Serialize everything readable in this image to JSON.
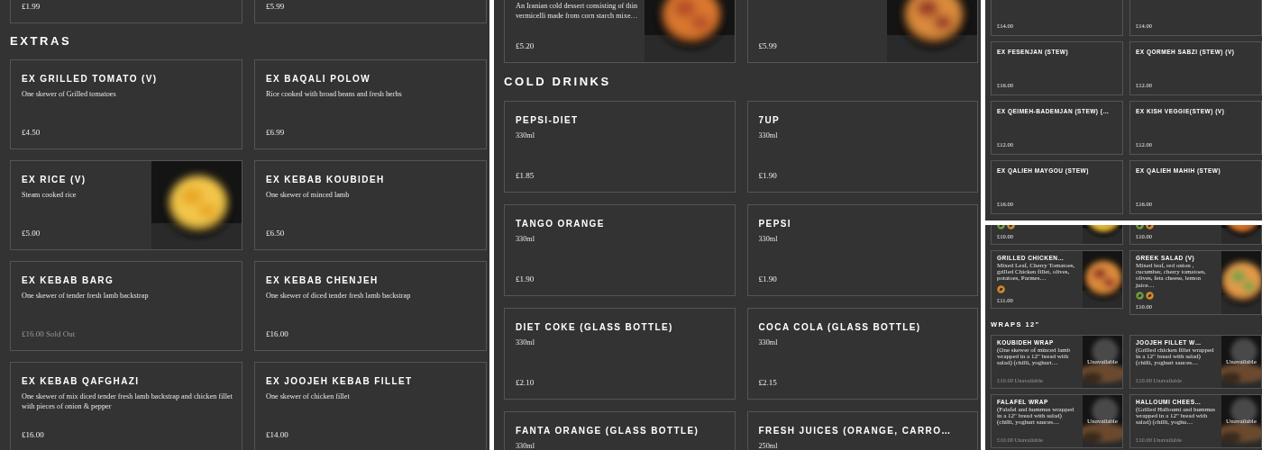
{
  "panels": [
    {
      "items": [
        {
          "kind": "card",
          "price": "£1.99"
        },
        {
          "kind": "card",
          "price": "£5.99"
        },
        {
          "kind": "heading",
          "title": "EXTRAS"
        },
        {
          "kind": "card",
          "title": "EX GRILLED TOMATO (V)",
          "description": "One skewer of Grilled tomatoes",
          "price": "£4.50"
        },
        {
          "kind": "card",
          "title": "EX BAQALI POLOW",
          "description": "Rice cooked with broad beans and fresh herbs",
          "price": "£6.99"
        },
        {
          "kind": "card",
          "title": "EX RICE (V)",
          "description": "Steam cooked rice",
          "price": "£5.00",
          "image": true
        },
        {
          "kind": "card",
          "title": "EX KEBAB KOUBIDEH",
          "description": "One skewer of minced lamb",
          "price": "£6.50"
        },
        {
          "kind": "card",
          "title": "EX KEBAB BARG",
          "description": "One skewer of tender fresh lamb backstrap",
          "price": "£16.00",
          "note": "Sold Out",
          "greyed": true
        },
        {
          "kind": "card",
          "title": "EX KEBAB CHENJEH",
          "description": "One skewer of diced tender fresh lamb backstrap",
          "price": "£16.00"
        },
        {
          "kind": "card",
          "title": "EX KEBAB QAFGHAZI",
          "description": "One skewer of mix diced tender fresh lamb backstrap and chicken fillet with pieces of onion & pepper",
          "price": "£16.00"
        },
        {
          "kind": "card",
          "title": "EX JOOJEH KEBAB FILLET",
          "description": "One skewer of chicken fillet",
          "price": "£14.00"
        }
      ]
    },
    {
      "items": [
        {
          "kind": "card",
          "description": "An Iranian cold dessert consisting of thin vermicelli made from corn starch mixe…",
          "price": "£5.20",
          "image": true
        },
        {
          "kind": "card",
          "price": "£5.99",
          "image": true
        },
        {
          "kind": "heading",
          "title": "COLD DRINKS"
        },
        {
          "kind": "card",
          "title": "PEPSI-DIET",
          "description": "330ml",
          "price": "£1.85"
        },
        {
          "kind": "card",
          "title": "7UP",
          "description": "330ml",
          "price": "£1.90"
        },
        {
          "kind": "card",
          "title": "TANGO ORANGE",
          "description": "330ml",
          "price": "£1.90"
        },
        {
          "kind": "card",
          "title": "PEPSI",
          "description": "330ml",
          "price": "£1.90"
        },
        {
          "kind": "card",
          "title": "DIET COKE (GLASS BOTTLE)",
          "description": "330ml",
          "price": "£2.10"
        },
        {
          "kind": "card",
          "title": "COCA COLA (GLASS BOTTLE)",
          "description": "330ml",
          "price": "£2.15"
        },
        {
          "kind": "card",
          "title": "FANTA ORANGE (GLASS BOTTLE)",
          "description": "330ml"
        },
        {
          "kind": "card",
          "title": "FRESH JUICES (ORANGE, CARRO…",
          "description": "250ml"
        }
      ]
    },
    {
      "items": [
        {
          "kind": "card",
          "price": "£14.00"
        },
        {
          "kind": "card",
          "price": "£14.00"
        },
        {
          "kind": "card",
          "title": "EX FESENJAN (STEW)",
          "price": "£16.00"
        },
        {
          "kind": "card",
          "title": "EX QORMEH SABZI (STEW) (V)",
          "price": "£12.00"
        },
        {
          "kind": "card",
          "title": "EX QEIMEH-BADEMJAN (STEW) (…",
          "price": "£12.00"
        },
        {
          "kind": "card",
          "title": "EX KISH VEGGIE(STEW) (V)",
          "price": "£12.00"
        },
        {
          "kind": "card",
          "title": "EX QALIEH MAYGOU (STEW)",
          "price": "£16.00"
        },
        {
          "kind": "card",
          "title": "EX QALIEH MAHIH (STEW)",
          "price": "£16.00"
        }
      ]
    },
    {
      "items": [
        {
          "kind": "card",
          "badges": [
            {
              "color": "#6f9a3e"
            },
            {
              "color": "#d1892b"
            }
          ],
          "price": "£10.00",
          "image": true
        },
        {
          "kind": "card",
          "badges": [
            {
              "color": "#6f9a3e"
            },
            {
              "color": "#d1892b"
            }
          ],
          "price": "£10.00",
          "image": true
        },
        {
          "kind": "card",
          "title": "GRILLED CHICKEN…",
          "description": "Mixed Leaf, Cherry Tomatoes, grilled Chicken fillet, olives, potatoes, Parmes…",
          "badges": [
            {
              "color": "#d1892b"
            }
          ],
          "price": "£11.00",
          "image": true
        },
        {
          "kind": "card",
          "title": "GREEK SALAD (V)",
          "description": "Mixed leaf, red onion , cucumber, cherry tomatoes, olives, feta cheese, lemon juice…",
          "badges": [
            {
              "color": "#6f9a3e"
            },
            {
              "color": "#d1892b"
            }
          ],
          "price": "£10.00",
          "image": true
        },
        {
          "kind": "heading",
          "title": "WRAPS 12\""
        },
        {
          "kind": "card",
          "title": "KOUBIDEH WRAP",
          "description": "(One skewer of minced lamb wrapped in a 12\" bread with salad) (chilli, yoghurt…",
          "price": "£10.00",
          "note": "Unavailable",
          "greyed": true,
          "image": true,
          "image_label": "Unavailable"
        },
        {
          "kind": "card",
          "title": "JOOJEH FILLET W…",
          "description": "(Grilled chicken fillet wrapped in a 12\" bread with salad) (chilli, yoghurt sauces…",
          "price": "£10.00",
          "note": "Unavailable",
          "greyed": true,
          "image": true,
          "image_label": "Unavailable"
        },
        {
          "kind": "card",
          "title": "FALAFEL WRAP",
          "description": "(Falafel and hummus wrapped in a 12\" bread with salad) (chilli, yoghurt sauces…",
          "price": "£10.00",
          "note": "Unavailable",
          "greyed": true,
          "image": true,
          "image_label": "Unavailable"
        },
        {
          "kind": "card",
          "title": "HALLOUMI CHEES…",
          "description": "(Grilled Halloumi and hummus wrapped in a 12\" bread with salad) (chilli, yoghu…",
          "price": "£10.00",
          "note": "Unavailable",
          "greyed": true,
          "image": true,
          "image_label": "Unavailable"
        }
      ]
    }
  ]
}
